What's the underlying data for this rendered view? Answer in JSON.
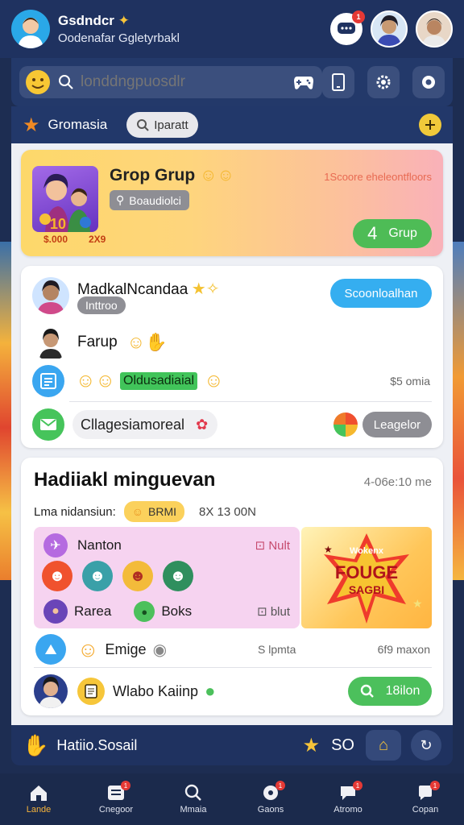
{
  "header": {
    "title": "Gsdndcr",
    "subtitle": "Oodenafar Ggletyrbakl",
    "chat_badge": "1"
  },
  "search": {
    "placeholder": "londdngpuosdlr"
  },
  "category": {
    "label": "Gromasia",
    "chip": "Iparatt"
  },
  "group_card": {
    "title": "Grop Grup",
    "chip": "Boaudiolci",
    "score": "1Scoore eheleontfloors",
    "coin_left": "10",
    "coin_price": "$.000",
    "coin_right": "2X9",
    "button": "Grup",
    "button_num": "4"
  },
  "friends": {
    "rows": [
      {
        "name": "MadkalNcandaa",
        "status": "Inttroo"
      },
      {
        "name": "Farup"
      },
      {
        "highlight": "Oldusadiaial",
        "meta": "$5 omia"
      },
      {
        "name": "Cllagesiamoreal",
        "button": "Leagelor"
      }
    ],
    "action_button": "Scoonloalhan"
  },
  "event": {
    "title": "Hadiiakl minguevan",
    "time": "4-06e:10 me",
    "meta_label": "Lma nidansiun:",
    "meta_chip": "BRMI",
    "meta_count": "8X 13 00N",
    "pink_rows": [
      {
        "label": "Nanton",
        "tag": "Nult"
      },
      {
        "label": "Rarea",
        "label2": "Boks",
        "tag": "blut"
      }
    ],
    "promo_top": "Wokenx",
    "promo_main": "FOUGE",
    "promo_sub": "SAGBI",
    "row_emoji": {
      "label": "Emige",
      "meta_left": "S lpmta",
      "meta_right": "6f9 maxon"
    },
    "row_user": {
      "name": "Wlabo Kaiinp",
      "button": "18ilon"
    }
  },
  "social_bar": {
    "label": "Hatiio.Sosail",
    "icon_text": "SO"
  },
  "nav": [
    {
      "label": "Lande",
      "active": true
    },
    {
      "label": "Cnegoor",
      "badge": "1"
    },
    {
      "label": "Mmaia"
    },
    {
      "label": "Gaons",
      "badge": "1"
    },
    {
      "label": "Atromo",
      "badge": "1"
    },
    {
      "label": "Copan",
      "badge": "1"
    }
  ],
  "colors": {
    "header": "#1f3260",
    "accent_blue": "#35aef0",
    "accent_green": "#4cc05c",
    "accent_yellow": "#f5b33b"
  }
}
